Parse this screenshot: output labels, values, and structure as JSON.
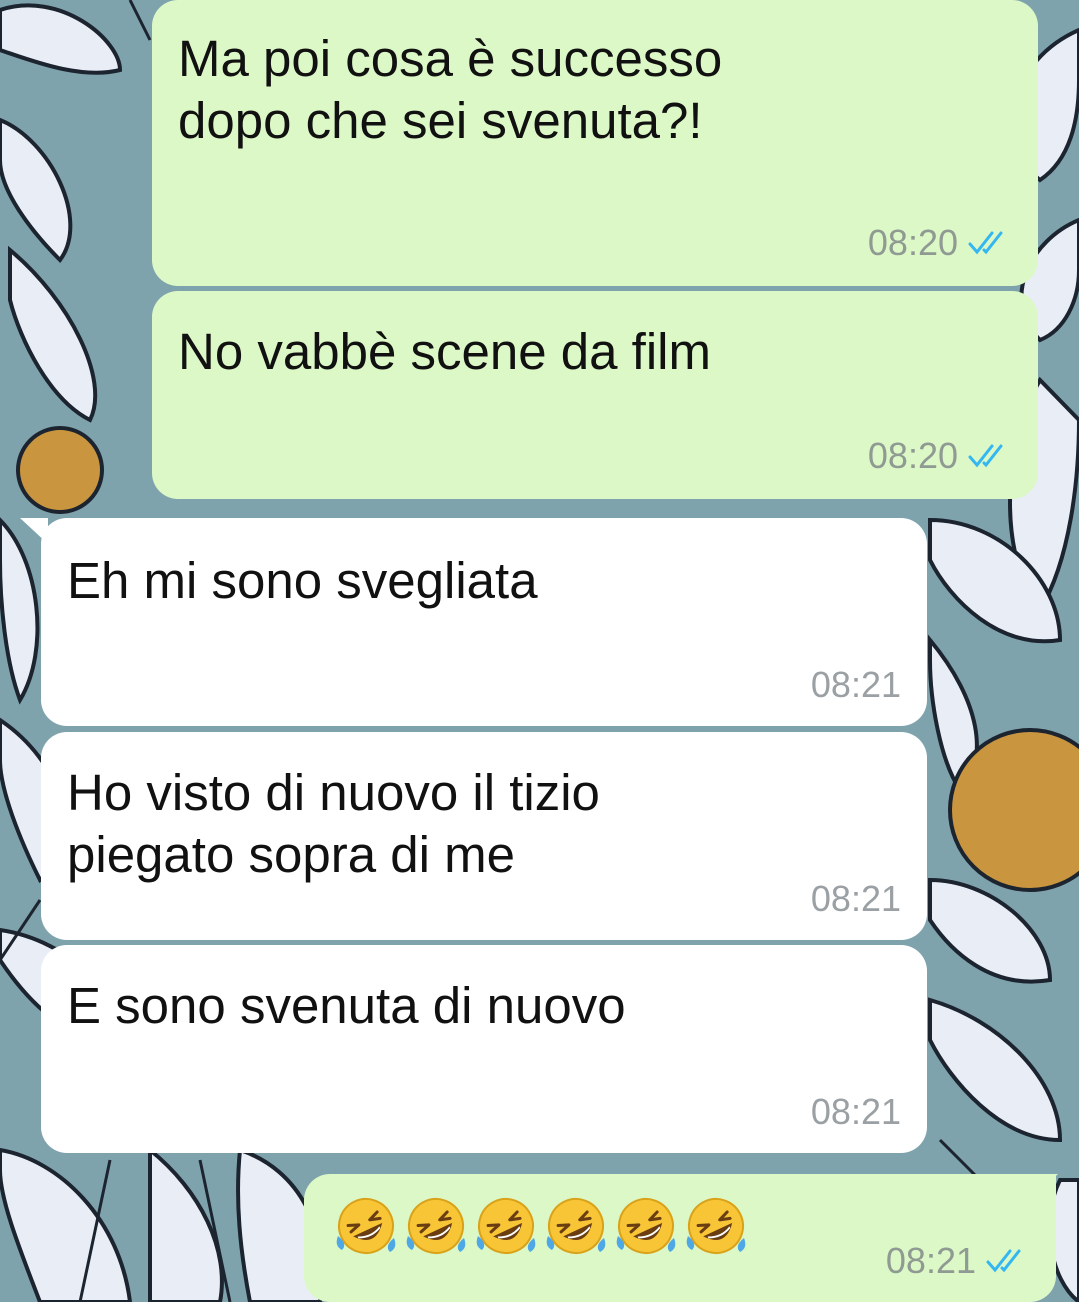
{
  "messages": [
    {
      "direction": "outgoing",
      "text": "Ma poi cosa è successo\ndopo che sei svenuta?!",
      "time": "08:20",
      "status": "read"
    },
    {
      "direction": "outgoing",
      "text": "No vabbè scene da film",
      "time": "08:20",
      "status": "read"
    },
    {
      "direction": "incoming",
      "text": "Eh mi sono svegliata",
      "time": "08:21"
    },
    {
      "direction": "incoming",
      "text": "Ho visto di nuovo il tizio\npiegato sopra di me",
      "time": "08:21"
    },
    {
      "direction": "incoming",
      "text": "E sono svenuta di nuovo",
      "time": "08:21"
    },
    {
      "direction": "outgoing",
      "emoji_name": "rolling-on-the-floor-laughing-emoji",
      "emoji_count": 6,
      "time": "08:21",
      "status": "read"
    }
  ],
  "colors": {
    "outgoing_bubble": "#dcf8c6",
    "incoming_bubble": "#ffffff",
    "read_ticks": "#34b7f1",
    "wallpaper": "#7fa3ad"
  },
  "icons": {
    "read_receipt": "double-check-icon"
  }
}
